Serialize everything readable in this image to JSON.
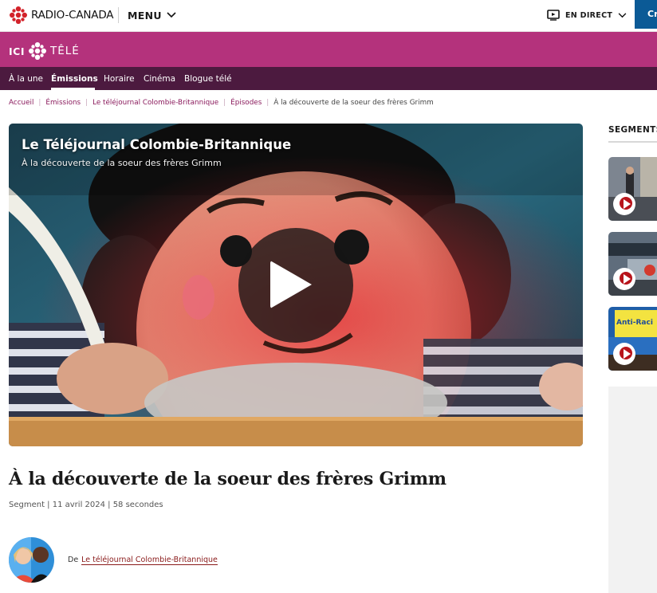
{
  "header": {
    "logo_text": "RADIO-CANADA",
    "menu_label": "MENU",
    "live_label": "EN DIRECT",
    "create_label": "Cr"
  },
  "brand": {
    "ici": "ICI",
    "tele": "TÊLÉ"
  },
  "nav": {
    "items": [
      {
        "label": "À la une"
      },
      {
        "label": "Émissions"
      },
      {
        "label": "Horaire"
      },
      {
        "label": "Cinéma"
      },
      {
        "label": "Blogue télé"
      }
    ],
    "active_index": 1
  },
  "breadcrumb": {
    "items": [
      "Accueil",
      "Émissions",
      "Le téléjournal Colombie-Britannique",
      "Épisodes"
    ],
    "current": "À la découverte de la soeur des frères Grimm"
  },
  "player": {
    "show_title": "Le Téléjournal Colombie-Britannique",
    "episode_subtitle": "À la découverte de la soeur des frères Grimm"
  },
  "article": {
    "title": "À la découverte de la soeur des frères Grimm",
    "meta": "Segment | 11 avril 2024 | 58 secondes"
  },
  "author": {
    "prefix": "De",
    "link_text": "Le téléjournal Colombie-Britannique"
  },
  "sidebar": {
    "heading": "SEGMENTS",
    "thumb3_banner": "Anti-Raci"
  },
  "colors": {
    "brand_magenta": "#b4327c",
    "nav_plum": "#4c1a3f",
    "cbc_red": "#d3222a",
    "create_blue": "#0b5a96"
  },
  "icons": [
    "cbc-gem-icon",
    "chevron-down-icon",
    "tv-live-icon",
    "play-icon"
  ]
}
